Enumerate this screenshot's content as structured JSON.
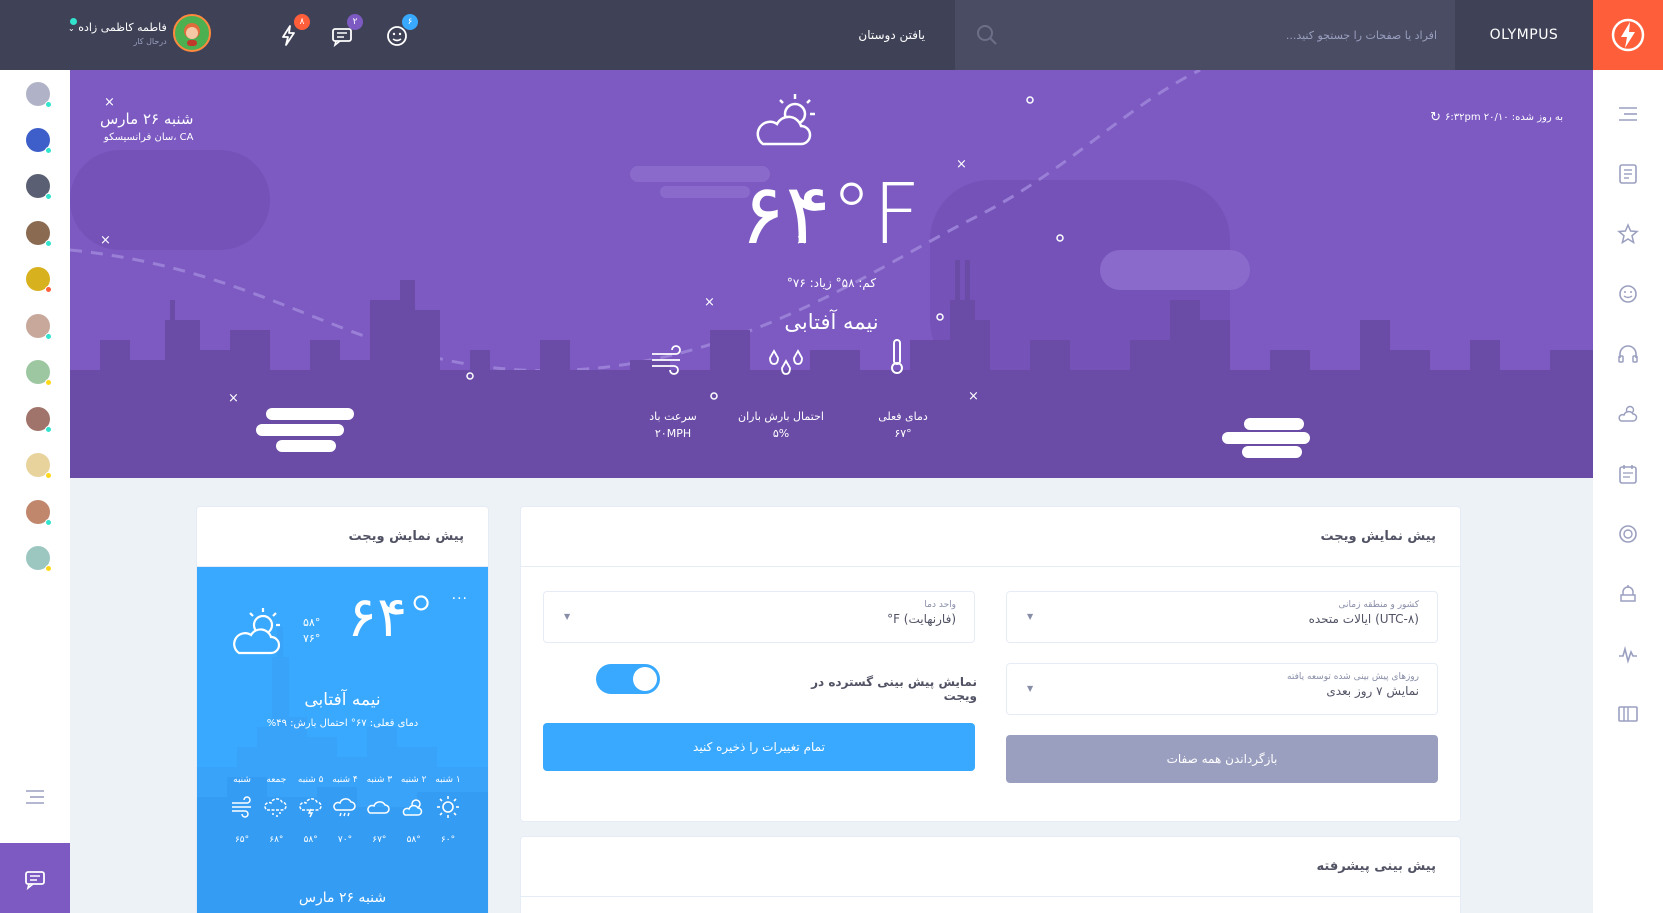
{
  "topbar": {
    "brand": "OLYMPUS",
    "search_placeholder": "افراد یا صفحات را جستجو کنید...",
    "find_friends": "یافتن دوستان",
    "notifications": {
      "friends_count": "۶",
      "messages_count": "۲",
      "activity_count": "۸"
    },
    "user": {
      "name": "فاطمه کاظمی زاده",
      "role": "درحال کار"
    }
  },
  "hero": {
    "date": "شنبه ۲۶ مارس",
    "location": "سان فرانسیسکو، CA",
    "updated": "به روز شده: ۶:۳۲pm ۲۰/۱۰",
    "temperature": "۶۴°F",
    "minmax": "کم: ۵۸°  زیاد: ۷۶°",
    "condition": "نیمه آفتابی",
    "stats": {
      "current_label": "دمای فعلی",
      "current_value": "۶۷°",
      "rain_label": "احتمال بارش باران",
      "rain_value": "۵%",
      "wind_label": "سرعت باد",
      "wind_value": "۲۰MPH"
    }
  },
  "settings_card": {
    "title": "پیش نمایش ویجت",
    "country_label": "کشور و منطقه زمانی",
    "country_value": "ایالات متحده (UTC-۸)",
    "unit_label": "واحد دما",
    "unit_value": "°F (فارنهایت)",
    "forecast_label": "روزهای پیش بینی شده توسعه یافته",
    "forecast_value": "نمایش ۷ روز بعدی",
    "toggle_label": "نمایش پیش بینی گسترده در ویجت",
    "reset_button": "بازگرداندن همه صفات",
    "save_button": "تمام تغییرات را ذخیره کنید"
  },
  "preview_card": {
    "title": "پیش نمایش ویجت",
    "temp": "۶۴°",
    "dots": "...",
    "low": "۵۸°",
    "high": "۷۶°",
    "condition": "نیمه آفتابی",
    "subline": "دمای فعلی: ۶۷°   احتمال بارش: ۴۹%",
    "days": [
      {
        "name": "۱ شنبه",
        "icon": "sun-icon",
        "temp": "۶۰°"
      },
      {
        "name": "۲ شنبه",
        "icon": "partly-sunny-icon",
        "temp": "۵۸°"
      },
      {
        "name": "۳ شنبه",
        "icon": "cloud-icon",
        "temp": "۶۷°"
      },
      {
        "name": "۴ شنبه",
        "icon": "rain-cloud-icon",
        "temp": "۷۰°"
      },
      {
        "name": "۵ شنبه",
        "icon": "storm-cloud-icon",
        "temp": "۵۸°"
      },
      {
        "name": "جمعه",
        "icon": "snow-cloud-icon",
        "temp": "۶۸°"
      },
      {
        "name": "شنبه",
        "icon": "wind-icon",
        "temp": "۶۵°"
      }
    ],
    "date": "شنبه ۲۶ مارس"
  },
  "advanced_card": {
    "title": "پیش بینی پیشرفته"
  },
  "colors": {
    "topbar": "#3f4257",
    "accent_orange": "#ff5e3a",
    "hero_purple": "#7c5ac2",
    "blue": "#38a9ff",
    "grey_button": "#9a9fbf"
  }
}
